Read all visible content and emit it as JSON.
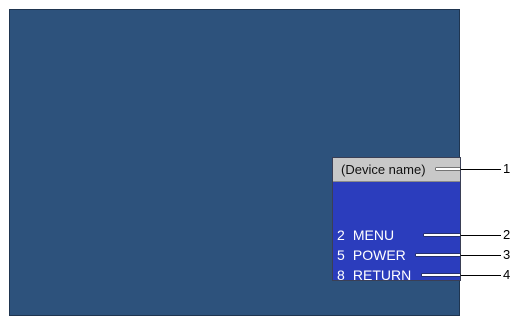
{
  "device_panel": {
    "device_name": "(Device name)",
    "items": [
      {
        "number": "2",
        "label": "MENU"
      },
      {
        "number": "5",
        "label": "POWER"
      },
      {
        "number": "8",
        "label": "RETURN"
      }
    ]
  },
  "callouts": [
    "1",
    "2",
    "3",
    "4"
  ],
  "colors": {
    "screen_background": "#2d527c",
    "panel_background": "#2b3dbd",
    "device_name_bar": "#c8c8c8",
    "text_on_panel": "#ffffff"
  }
}
